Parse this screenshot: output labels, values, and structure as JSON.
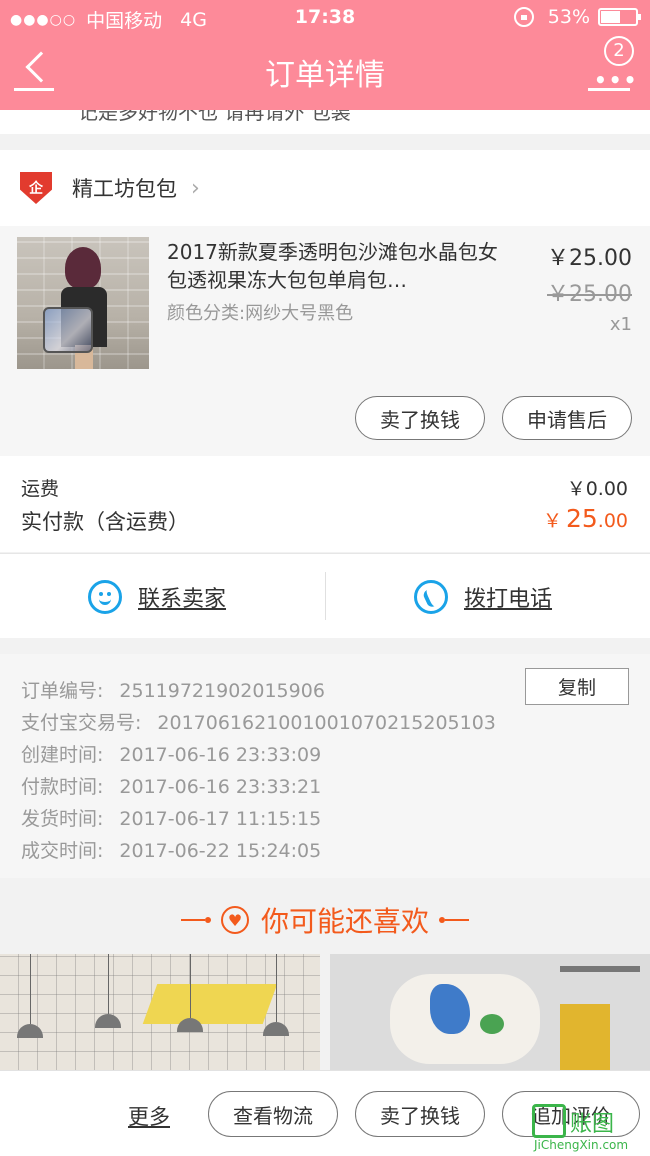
{
  "status_bar": {
    "signal_dots": "●●●○○",
    "carrier": "中国移动",
    "network": "4G",
    "time": "17:38",
    "battery_percent": "53%",
    "battery_level": 0.53
  },
  "nav": {
    "title": "订单详情",
    "badge_count": "2"
  },
  "partial_line": "记是多好物不也 请再请外 包装",
  "shop": {
    "icon_text": "企",
    "name": "精工坊包包",
    "arrow": "›"
  },
  "item": {
    "title": "2017新款夏季透明包沙滩包水晶包女包透视果冻大包包单肩包…",
    "sku": "颜色分类:网纱大号黑色",
    "price": "￥25.00",
    "original_price": "￥25.00",
    "quantity": "x1",
    "sell_button": "卖了换钱",
    "after_sale_button": "申请售后"
  },
  "fees": {
    "shipping_label": "运费",
    "shipping_value": "￥0.00",
    "paid_label": "实付款（含运费）",
    "paid_currency": "￥",
    "paid_integer": "25",
    "paid_decimal": ".00"
  },
  "contact": {
    "seller_label": "联系卖家",
    "call_label": "拨打电话"
  },
  "order_info": {
    "copy_label": "复制",
    "rows": [
      {
        "key": "订单编号:",
        "value": "25119721902015906"
      },
      {
        "key": "支付宝交易号:",
        "value": "2017061621001001070215205103"
      },
      {
        "key": "创建时间:",
        "value": "2017-06-16 23:33:09"
      },
      {
        "key": "付款时间:",
        "value": "2017-06-16 23:33:21"
      },
      {
        "key": "发货时间:",
        "value": "2017-06-17 11:15:15"
      },
      {
        "key": "成交时间:",
        "value": "2017-06-22 15:24:05"
      }
    ]
  },
  "recommend": {
    "title": "你可能还喜欢"
  },
  "bottom_bar": {
    "more": "更多",
    "logistics": "查看物流",
    "sell": "卖了换钱",
    "review": "追加评价"
  },
  "watermark": {
    "text": "账图",
    "url": "JiChengXin.com"
  },
  "colors": {
    "header_pink": "#fd8a99",
    "accent_orange": "#f35a1c",
    "contact_blue": "#1aa3e8",
    "watermark_green": "#3bb54a"
  }
}
